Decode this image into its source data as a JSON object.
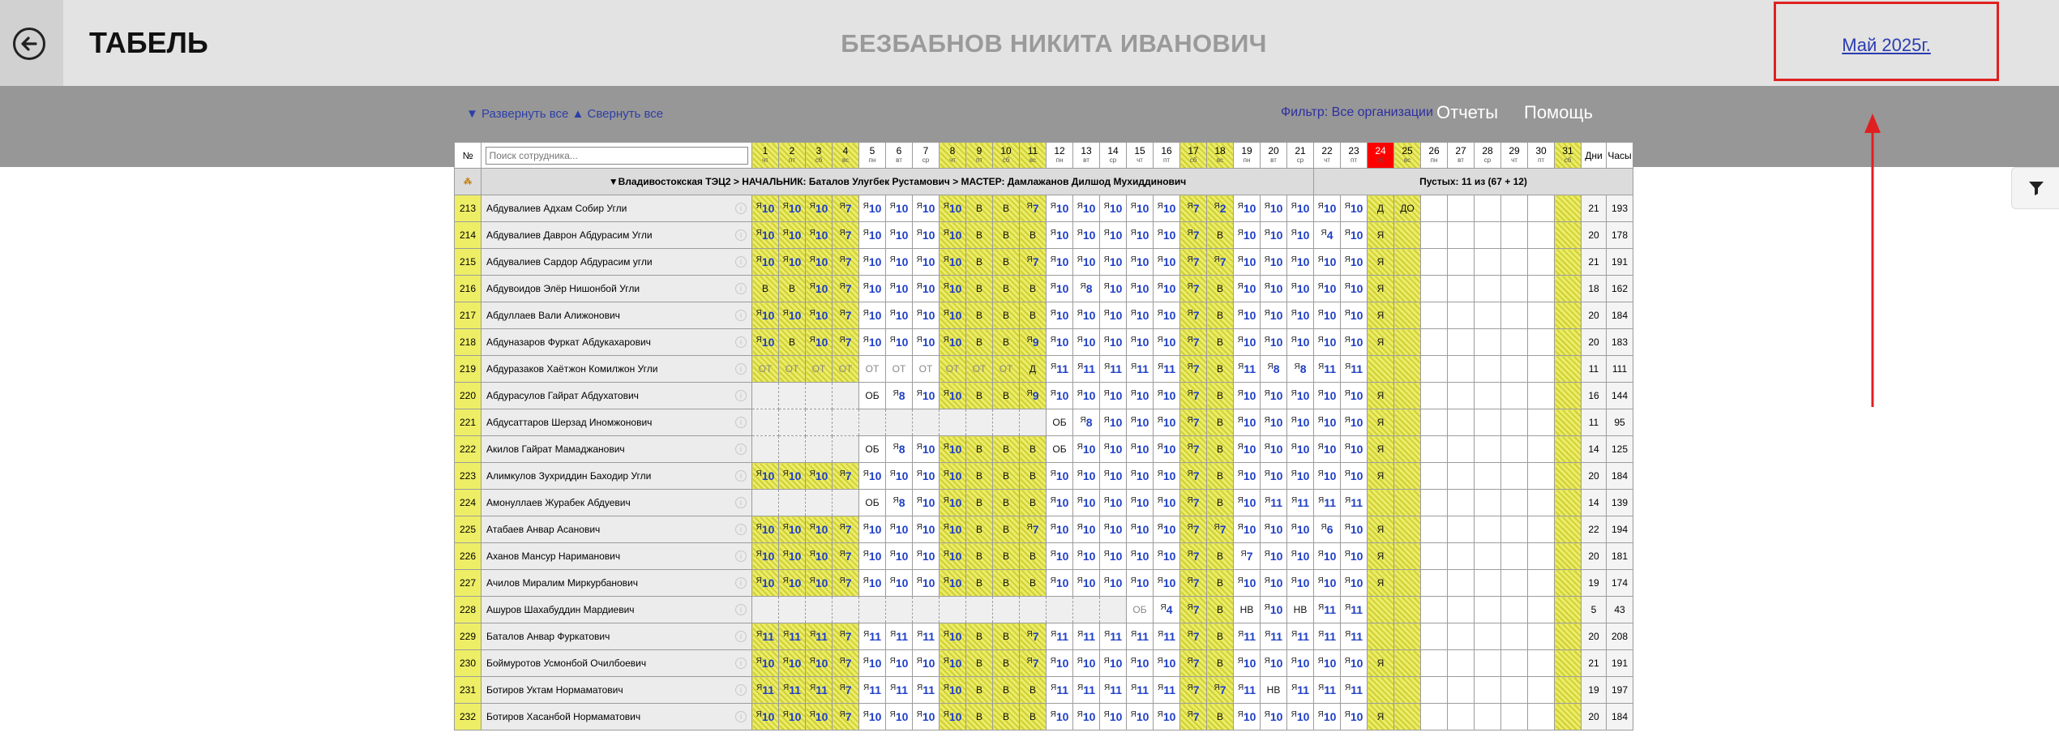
{
  "header": {
    "title": "ТАБЕЛЬ",
    "employee": "БЕЗБАБНОВ НИКИТА ИВАНОВИЧ",
    "month": "Май 2025г."
  },
  "toolbar": {
    "expand_all": "▼ Развернуть все",
    "collapse_all": "▲ Свернуть все",
    "filter": "Фильтр: Все организации",
    "reports": "Отчеты",
    "help": "Помощь"
  },
  "table": {
    "col_num": "№",
    "search_placeholder": "Поиск сотрудника...",
    "col_days": "Дни",
    "col_hours": "Часы",
    "days": [
      [
        "1",
        "чт"
      ],
      [
        "2",
        "пт"
      ],
      [
        "3",
        "сб"
      ],
      [
        "4",
        "вс"
      ],
      [
        "5",
        "пн"
      ],
      [
        "6",
        "вт"
      ],
      [
        "7",
        "ср"
      ],
      [
        "8",
        "чт"
      ],
      [
        "9",
        "пт"
      ],
      [
        "10",
        "сб"
      ],
      [
        "11",
        "вс"
      ],
      [
        "12",
        "пн"
      ],
      [
        "13",
        "вт"
      ],
      [
        "14",
        "ср"
      ],
      [
        "15",
        "чт"
      ],
      [
        "16",
        "пт"
      ],
      [
        "17",
        "сб"
      ],
      [
        "18",
        "вс"
      ],
      [
        "19",
        "пн"
      ],
      [
        "20",
        "вт"
      ],
      [
        "21",
        "ср"
      ],
      [
        "22",
        "чт"
      ],
      [
        "23",
        "пт"
      ],
      [
        "24",
        "сб"
      ],
      [
        "25",
        "вс"
      ],
      [
        "26",
        "пн"
      ],
      [
        "27",
        "вт"
      ],
      [
        "28",
        "ср"
      ],
      [
        "29",
        "чт"
      ],
      [
        "30",
        "пт"
      ],
      [
        "31",
        "сб"
      ]
    ],
    "hatched_days": [
      1,
      2,
      3,
      4,
      8,
      9,
      10,
      11,
      17,
      18,
      24,
      25,
      31
    ],
    "today": 24,
    "group_label": "▼Владивостокская ТЭЦ2 > НАЧАЛЬНИК: Баталов Улугбек Рустамович > МАСТЕР: Дамлажанов Дилшод Мухиддинович",
    "group_empty": "Пустых: 11 из (67 + 12)",
    "rows": [
      {
        "n": "213",
        "name": "Абдувалиев Адхам Собир Угли",
        "cells": [
          "Я10",
          "Я10",
          "Я10",
          "Я7",
          "Я10",
          "Я10",
          "Я10",
          "Я10",
          "В",
          "В",
          "Я7",
          "Я10",
          "Я10",
          "Я10",
          "Я10",
          "Я10",
          "Я7",
          "Я2",
          "Я10",
          "Я10",
          "Я10",
          "Я10",
          "Я10",
          "Д",
          "ДО"
        ],
        "days": "21",
        "hours": "193"
      },
      {
        "n": "214",
        "name": "Абдувалиев Даврон Абдурасим Угли",
        "cells": [
          "Я10",
          "Я10",
          "Я10",
          "Я7",
          "Я10",
          "Я10",
          "Я10",
          "Я10",
          "В",
          "В",
          "В",
          "Я10",
          "Я10",
          "Я10",
          "Я10",
          "Я10",
          "Я7",
          "В",
          "Я10",
          "Я10",
          "Я10",
          "Я4",
          "Я10",
          "Я"
        ],
        "days": "20",
        "hours": "178"
      },
      {
        "n": "215",
        "name": "Абдувалиев Сардор Абдурасим угли",
        "cells": [
          "Я10",
          "Я10",
          "Я10",
          "Я7",
          "Я10",
          "Я10",
          "Я10",
          "Я10",
          "В",
          "В",
          "Я7",
          "Я10",
          "Я10",
          "Я10",
          "Я10",
          "Я10",
          "Я7",
          "Я7",
          "Я10",
          "Я10",
          "Я10",
          "Я10",
          "Я10",
          "Я"
        ],
        "days": "21",
        "hours": "191"
      },
      {
        "n": "216",
        "name": "Абдувоидов Элёр Нишонбой Угли",
        "cells": [
          "В",
          "В",
          "Я10",
          "Я7",
          "Я10",
          "Я10",
          "Я10",
          "Я10",
          "В",
          "В",
          "В",
          "Я10",
          "Я8",
          "Я10",
          "Я10",
          "Я10",
          "Я7",
          "В",
          "Я10",
          "Я10",
          "Я10",
          "Я10",
          "Я10",
          "Я"
        ],
        "days": "18",
        "hours": "162"
      },
      {
        "n": "217",
        "name": "Абдуллаев Вали Алижонович",
        "cells": [
          "Я10",
          "Я10",
          "Я10",
          "Я7",
          "Я10",
          "Я10",
          "Я10",
          "Я10",
          "В",
          "В",
          "В",
          "Я10",
          "Я10",
          "Я10",
          "Я10",
          "Я10",
          "Я7",
          "В",
          "Я10",
          "Я10",
          "Я10",
          "Я10",
          "Я10",
          "Я"
        ],
        "days": "20",
        "hours": "184"
      },
      {
        "n": "218",
        "name": "Абдуназаров Фуркат Абдукахарович",
        "cells": [
          "Я10",
          "В",
          "Я10",
          "Я7",
          "Я10",
          "Я10",
          "Я10",
          "Я10",
          "В",
          "В",
          "Я9",
          "Я10",
          "Я10",
          "Я10",
          "Я10",
          "Я10",
          "Я7",
          "В",
          "Я10",
          "Я10",
          "Я10",
          "Я10",
          "Я10",
          "Я"
        ],
        "days": "20",
        "hours": "183"
      },
      {
        "n": "219",
        "name": "Абдуразаков Хаётжон Комилжон Угли",
        "cells": [
          "ОТ",
          "ОТ",
          "ОТ",
          "ОТ",
          "ОТ",
          "ОТ",
          "ОТ",
          "ОТ",
          "ОТ",
          "ОТ",
          "Д",
          "Я11",
          "Я11",
          "Я11",
          "Я11",
          "Я11",
          "Я7",
          "В",
          "Я11",
          "Я8",
          "Я8",
          "Я11",
          "Я11",
          ""
        ],
        "days": "11",
        "hours": "111"
      },
      {
        "n": "220",
        "name": "Абдурасулов Гайрат Абдухатович",
        "cells": [
          "-",
          "-",
          "-",
          "-",
          "ОБ",
          "Я8",
          "Я10",
          "Я10",
          "В",
          "В",
          "Я9",
          "Я10",
          "Я10",
          "Я10",
          "Я10",
          "Я10",
          "Я7",
          "В",
          "Я10",
          "Я10",
          "Я10",
          "Я10",
          "Я10",
          "Я"
        ],
        "days": "16",
        "hours": "144"
      },
      {
        "n": "221",
        "name": "Абдусаттаров Шерзад Иномжонович",
        "cells": [
          "-",
          "-",
          "-",
          "-",
          "-",
          "-",
          "-",
          "-",
          "-",
          "-",
          "-",
          "ОБ",
          "Я8",
          "Я10",
          "Я10",
          "Я10",
          "Я7",
          "В",
          "Я10",
          "Я10",
          "Я10",
          "Я10",
          "Я10",
          "Я"
        ],
        "days": "11",
        "hours": "95"
      },
      {
        "n": "222",
        "name": "Акилов Гайрат Мамаджанович",
        "cells": [
          "-",
          "-",
          "-",
          "-",
          "ОБ",
          "Я8",
          "Я10",
          "Я10",
          "В",
          "В",
          "В",
          "ОБ",
          "Я10",
          "Я10",
          "Я10",
          "Я10",
          "Я7",
          "В",
          "Я10",
          "Я10",
          "Я10",
          "Я10",
          "Я10",
          "Я"
        ],
        "days": "14",
        "hours": "125"
      },
      {
        "n": "223",
        "name": "Алимкулов Зухриддин Баходир Угли",
        "cells": [
          "Я10",
          "Я10",
          "Я10",
          "Я7",
          "Я10",
          "Я10",
          "Я10",
          "Я10",
          "В",
          "В",
          "В",
          "Я10",
          "Я10",
          "Я10",
          "Я10",
          "Я10",
          "Я7",
          "В",
          "Я10",
          "Я10",
          "Я10",
          "Я10",
          "Я10",
          "Я"
        ],
        "days": "20",
        "hours": "184"
      },
      {
        "n": "224",
        "name": "Амонуллаев Журабек Абдуевич",
        "cells": [
          "-",
          "-",
          "-",
          "-",
          "ОБ",
          "Я8",
          "Я10",
          "Я10",
          "В",
          "В",
          "В",
          "Я10",
          "Я10",
          "Я10",
          "Я10",
          "Я10",
          "Я7",
          "В",
          "Я10",
          "Я11",
          "Я11",
          "Я11",
          "Я11",
          ""
        ],
        "days": "14",
        "hours": "139"
      },
      {
        "n": "225",
        "name": "Атабаев Анвар Асанович",
        "cells": [
          "Я10",
          "Я10",
          "Я10",
          "Я7",
          "Я10",
          "Я10",
          "Я10",
          "Я10",
          "В",
          "В",
          "Я7",
          "Я10",
          "Я10",
          "Я10",
          "Я10",
          "Я10",
          "Я7",
          "Я7",
          "Я10",
          "Я10",
          "Я10",
          "Я6",
          "Я10",
          "Я"
        ],
        "days": "22",
        "hours": "194"
      },
      {
        "n": "226",
        "name": "Аханов Мансур Нариманович",
        "cells": [
          "Я10",
          "Я10",
          "Я10",
          "Я7",
          "Я10",
          "Я10",
          "Я10",
          "Я10",
          "В",
          "В",
          "В",
          "Я10",
          "Я10",
          "Я10",
          "Я10",
          "Я10",
          "Я7",
          "В",
          "Я7",
          "Я10",
          "Я10",
          "Я10",
          "Я10",
          "Я"
        ],
        "days": "20",
        "hours": "181"
      },
      {
        "n": "227",
        "name": "Ачилов Миралим Миркурбанович",
        "cells": [
          "Я10",
          "Я10",
          "Я10",
          "Я7",
          "Я10",
          "Я10",
          "Я10",
          "Я10",
          "В",
          "В",
          "В",
          "Я10",
          "Я10",
          "Я10",
          "Я10",
          "Я10",
          "Я7",
          "В",
          "Я10",
          "Я10",
          "Я10",
          "Я10",
          "Я10",
          "Я"
        ],
        "days": "19",
        "hours": "174"
      },
      {
        "n": "228",
        "name": "Ашуров Шахабуддин Мардиевич",
        "cells": [
          "-",
          "-",
          "-",
          "-",
          "-",
          "-",
          "-",
          "-",
          "-",
          "-",
          "-",
          "-",
          "-",
          "-",
          "ОБ",
          "Я4",
          "Я7",
          "В",
          "НВ",
          "Я10",
          "НВ",
          "Я11",
          "Я11",
          ""
        ],
        "days": "5",
        "hours": "43"
      },
      {
        "n": "229",
        "name": "Баталов Анвар Фуркатович",
        "cells": [
          "Я11",
          "Я11",
          "Я11",
          "Я7",
          "Я11",
          "Я11",
          "Я11",
          "Я10",
          "В",
          "В",
          "Я7",
          "Я11",
          "Я11",
          "Я11",
          "Я11",
          "Я11",
          "Я7",
          "В",
          "Я11",
          "Я11",
          "Я11",
          "Я11",
          "Я11",
          ""
        ],
        "days": "20",
        "hours": "208"
      },
      {
        "n": "230",
        "name": "Боймуротов Усмонбой Очилбоевич",
        "cells": [
          "Я10",
          "Я10",
          "Я10",
          "Я7",
          "Я10",
          "Я10",
          "Я10",
          "Я10",
          "В",
          "В",
          "Я7",
          "Я10",
          "Я10",
          "Я10",
          "Я10",
          "Я10",
          "Я7",
          "В",
          "Я10",
          "Я10",
          "Я10",
          "Я10",
          "Я10",
          "Я"
        ],
        "days": "21",
        "hours": "191"
      },
      {
        "n": "231",
        "name": "Ботиров Уктам Нормаматович",
        "cells": [
          "Я11",
          "Я11",
          "Я11",
          "Я7",
          "Я11",
          "Я11",
          "Я11",
          "Я10",
          "В",
          "В",
          "В",
          "Я11",
          "Я11",
          "Я11",
          "Я11",
          "Я11",
          "Я7",
          "Я7",
          "Я11",
          "НВ",
          "Я11",
          "Я11",
          "Я11",
          ""
        ],
        "days": "19",
        "hours": "197"
      },
      {
        "n": "232",
        "name": "Ботиров Хасанбой Нормаматович",
        "cells": [
          "Я10",
          "Я10",
          "Я10",
          "Я7",
          "Я10",
          "Я10",
          "Я10",
          "Я10",
          "В",
          "В",
          "В",
          "Я10",
          "Я10",
          "Я10",
          "Я10",
          "Я10",
          "Я7",
          "В",
          "Я10",
          "Я10",
          "Я10",
          "Я10",
          "Я10",
          "Я"
        ],
        "days": "20",
        "hours": "184"
      }
    ]
  }
}
